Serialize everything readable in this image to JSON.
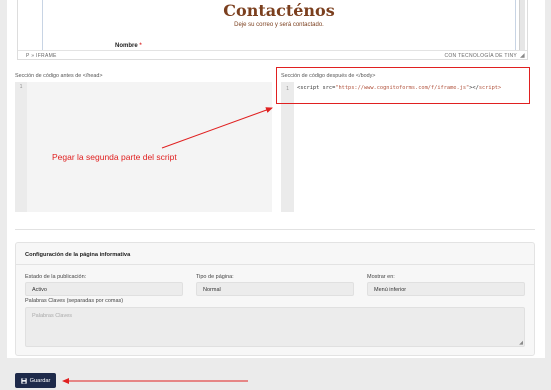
{
  "editor": {
    "contact_title": "Contacténos",
    "contact_subtitle": "Deje su correo y será contactado.",
    "name_label": "Nombre",
    "required_mark": "*",
    "status_path": "P » IFRAME",
    "status_brand": "CON TECNOLOGÍA DE TINY"
  },
  "code_sections": {
    "head_label": "Sección de código antes de </head>",
    "head_line_number": "1",
    "body_label": "Sección de código después de </body>",
    "body_line_number": "1",
    "body_code_open": "<script src=",
    "body_code_src": "\"https://www.cognitoforms.com/f/iframe.js\"",
    "body_code_mid": "></",
    "body_code_close": "script>"
  },
  "annotation": {
    "text": "Pegar la segunda parte del script",
    "color": "#e02020"
  },
  "config": {
    "title": "Configuración de la página informativa",
    "status_label": "Estado de la publicación:",
    "status_value": "Activo",
    "type_label": "Tipo de página:",
    "type_value": "Normal",
    "show_label": "Mostrar en:",
    "show_value": "Menú inferior",
    "keywords_label": "Palabras Claves (separadas por comas)",
    "keywords_placeholder": "Palabras Claves"
  },
  "actions": {
    "save_label": "Guardar",
    "save_icon": "floppy-disk-icon",
    "accent": "#1e2a4a"
  }
}
